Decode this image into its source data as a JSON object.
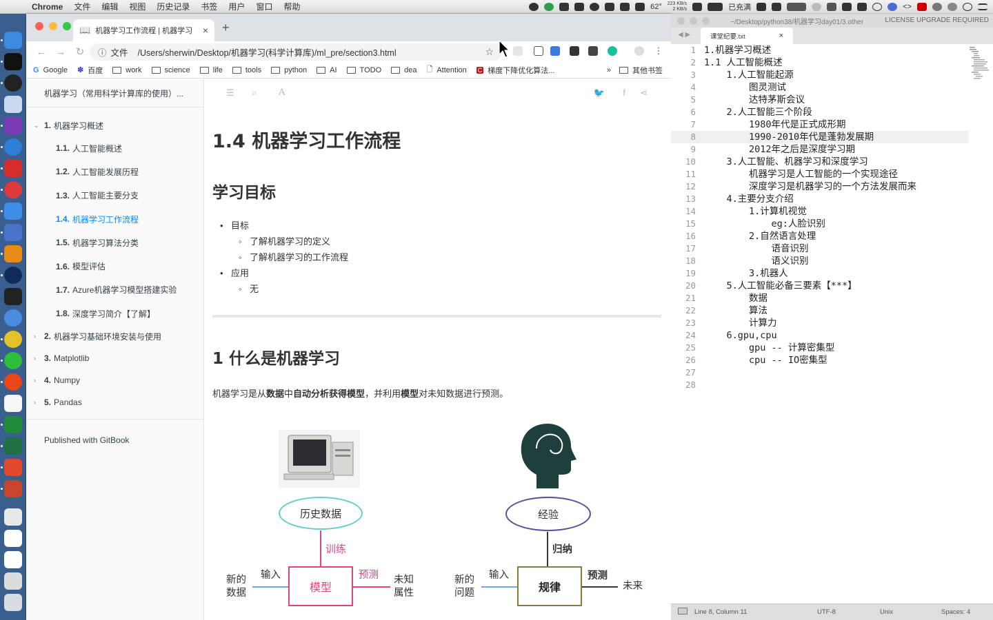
{
  "menubar": {
    "app": "Chrome",
    "items": [
      "文件",
      "编辑",
      "视图",
      "历史记录",
      "书签",
      "用户",
      "窗口",
      "帮助"
    ],
    "tray": {
      "temp": "62°",
      "net_up": "223 KB/s",
      "net_down": "2 KB/s",
      "battery": "已充满"
    }
  },
  "chrome": {
    "tab_title": "机器学习工作流程 | 机器学习",
    "url_scheme": "文件",
    "url": "/Users/sherwin/Desktop/机器学习(科学计算库)/ml_pre/section3.html",
    "bookmarks": [
      "Google",
      "百度",
      "work",
      "science",
      "life",
      "tools",
      "python",
      "AI",
      "TODO",
      "dea",
      "Attention",
      "梯度下降优化算法..."
    ],
    "bookmarks_more": "»",
    "other_bookmarks": "其他书签"
  },
  "gitbook": {
    "book_title": "机器学习（常用科学计算库的使用）...",
    "chapters": [
      {
        "num": "1.",
        "label": "机器学习概述",
        "expanded": true
      },
      {
        "num": "2.",
        "label": "机器学习基础环境安装与使用"
      },
      {
        "num": "3.",
        "label": "Matplotlib"
      },
      {
        "num": "4.",
        "label": "Numpy"
      },
      {
        "num": "5.",
        "label": "Pandas"
      }
    ],
    "sections": [
      {
        "num": "1.1.",
        "label": "人工智能概述"
      },
      {
        "num": "1.2.",
        "label": "人工智能发展历程"
      },
      {
        "num": "1.3.",
        "label": "人工智能主要分支"
      },
      {
        "num": "1.4.",
        "label": "机器学习工作流程",
        "active": true
      },
      {
        "num": "1.5.",
        "label": "机器学习算法分类"
      },
      {
        "num": "1.6.",
        "label": "模型评估"
      },
      {
        "num": "1.7.",
        "label": "Azure机器学习模型搭建实验"
      },
      {
        "num": "1.8.",
        "label": "深度学习简介【了解】"
      }
    ],
    "published": "Published with GitBook"
  },
  "page": {
    "h1": "1.4 机器学习工作流程",
    "h2_goal": "学习目标",
    "goal_label": "目标",
    "goals": [
      "了解机器学习的定义",
      "了解机器学习的工作流程"
    ],
    "apply_label": "应用",
    "apply": [
      "无"
    ],
    "h2_what": "1 什么是机器学习",
    "para_1": "机器学习是从",
    "para_b1": "数据",
    "para_2": "中",
    "para_b2": "自动分析获得模型",
    "para_3": "，并利用",
    "para_b3": "模型",
    "para_4": "对未知数据进行预测。",
    "figure": {
      "left": {
        "ellipse": "历史数据",
        "train": "训练",
        "input": "输入",
        "new_data": [
          "新的",
          "数据"
        ],
        "model": "模型",
        "predict": "预测",
        "unknown": [
          "未知",
          "属性"
        ]
      },
      "right": {
        "ellipse": "经验",
        "induce": "归纳",
        "input": "输入",
        "new_problem": [
          "新的",
          "问题"
        ],
        "rule": "规律",
        "predict": "预测",
        "future": "未来"
      }
    }
  },
  "sublime": {
    "title_path": "~/Desktop/python38/机器学习day01/3.other",
    "license": "LICENSE UPGRADE REQUIRED",
    "tab": "课堂纪要.txt",
    "lines": [
      "1.机器学习概述",
      "1.1 人工智能概述",
      "    1.人工智能起源",
      "        图灵测试",
      "        达特茅斯会议",
      "    2.人工智能三个阶段",
      "        1980年代是正式成形期",
      "        1990-2010年代是蓬勃发展期",
      "        2012年之后是深度学习期",
      "    3.人工智能、机器学习和深度学习",
      "        机器学习是人工智能的一个实现途径",
      "        深度学习是机器学习的一个方法发展而来",
      "    4.主要分支介绍",
      "        1.计算机视觉",
      "            eg:人脸识别",
      "        2.自然语言处理",
      "            语音识别",
      "            语义识别",
      "        3.机器人",
      "    5.人工智能必备三要素【***】",
      "        数据",
      "        算法",
      "        计算力",
      "    6.gpu,cpu",
      "        gpu -- 计算密集型",
      "        cpu -- IO密集型",
      "",
      ""
    ],
    "status": {
      "position": "Line 8, Column 11",
      "encoding": "UTF-8",
      "line_endings": "Unix",
      "indent": "Spaces: 4"
    }
  },
  "colors": {
    "accent_link": "#008cff",
    "dock": "#3a5f8f",
    "figure_red": "#e0457d",
    "ellipse_left": "#5fcfc7",
    "ellipse_right": "#5a4a9a"
  }
}
